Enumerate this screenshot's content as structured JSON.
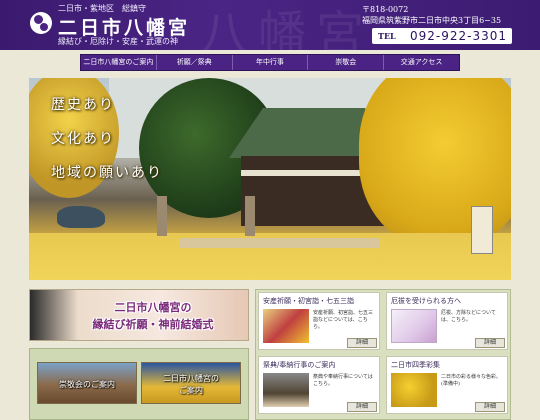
{
  "header": {
    "tagline": "二日市・紫地区　総鎮守",
    "shrine_name": "二日市八幡宮",
    "blessing": "縁結び・厄除け・安産・武運の神",
    "watermark": "八幡宮",
    "postal": "〒818-0072",
    "address": "福岡県筑紫野市二日市中央3丁目6−35",
    "tel_label": "TEL",
    "tel_number": "092-922-3301"
  },
  "nav": {
    "items": [
      {
        "label": "二日市八幡宮のご案内"
      },
      {
        "label": "祈願／祭典"
      },
      {
        "label": "年中行事"
      },
      {
        "label": "崇敬会"
      },
      {
        "label": "交通アクセス"
      }
    ]
  },
  "hero": {
    "lines": [
      "歴史あり",
      "文化あり",
      "地域の願いあり"
    ]
  },
  "banners": {
    "wedding_line1": "二日市八幡宮の",
    "wedding_line2": "縁結び祈願・神前結婚式",
    "sukeikai": "崇敬会のご案内",
    "guide_line1": "二日市八幡宮の",
    "guide_line2": "ご案内"
  },
  "cards": [
    {
      "title": "安産祈願・初宮詣・七五三詣",
      "desc": "安産祈願、初宮詣、七五三詣などについては、こちら。",
      "more": "詳細"
    },
    {
      "title": "厄祓を受けられる方へ",
      "desc": "厄祓、方除などについては、こちら。",
      "more": "詳細"
    },
    {
      "title": "祭典/奉納行事のご案内",
      "desc": "祭典や奉納行事についてはこちら。",
      "more": "詳細"
    },
    {
      "title": "二日市四季彩集",
      "desc": "二日市の彩る様々な色彩。(準備中)",
      "more": "詳細"
    }
  ]
}
